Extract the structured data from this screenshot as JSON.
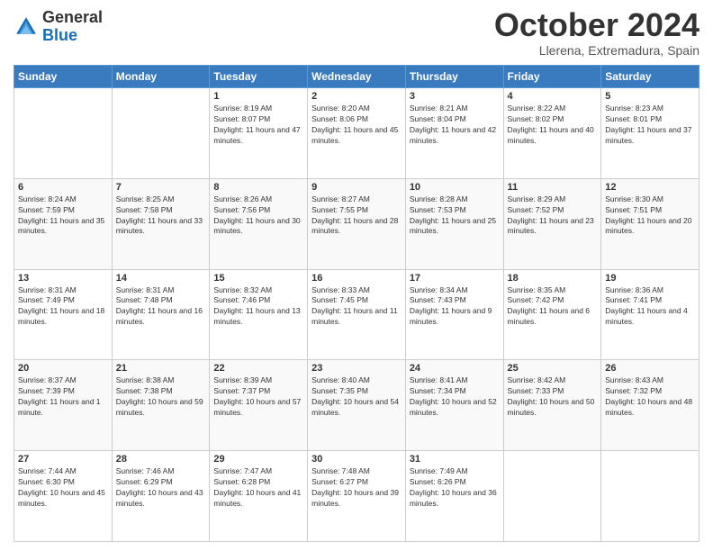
{
  "header": {
    "logo_general": "General",
    "logo_blue": "Blue",
    "month_title": "October 2024",
    "location": "Llerena, Extremadura, Spain"
  },
  "weekdays": [
    "Sunday",
    "Monday",
    "Tuesday",
    "Wednesday",
    "Thursday",
    "Friday",
    "Saturday"
  ],
  "weeks": [
    [
      {
        "day": "",
        "info": ""
      },
      {
        "day": "",
        "info": ""
      },
      {
        "day": "1",
        "info": "Sunrise: 8:19 AM\nSunset: 8:07 PM\nDaylight: 11 hours and 47 minutes."
      },
      {
        "day": "2",
        "info": "Sunrise: 8:20 AM\nSunset: 8:06 PM\nDaylight: 11 hours and 45 minutes."
      },
      {
        "day": "3",
        "info": "Sunrise: 8:21 AM\nSunset: 8:04 PM\nDaylight: 11 hours and 42 minutes."
      },
      {
        "day": "4",
        "info": "Sunrise: 8:22 AM\nSunset: 8:02 PM\nDaylight: 11 hours and 40 minutes."
      },
      {
        "day": "5",
        "info": "Sunrise: 8:23 AM\nSunset: 8:01 PM\nDaylight: 11 hours and 37 minutes."
      }
    ],
    [
      {
        "day": "6",
        "info": "Sunrise: 8:24 AM\nSunset: 7:59 PM\nDaylight: 11 hours and 35 minutes."
      },
      {
        "day": "7",
        "info": "Sunrise: 8:25 AM\nSunset: 7:58 PM\nDaylight: 11 hours and 33 minutes."
      },
      {
        "day": "8",
        "info": "Sunrise: 8:26 AM\nSunset: 7:56 PM\nDaylight: 11 hours and 30 minutes."
      },
      {
        "day": "9",
        "info": "Sunrise: 8:27 AM\nSunset: 7:55 PM\nDaylight: 11 hours and 28 minutes."
      },
      {
        "day": "10",
        "info": "Sunrise: 8:28 AM\nSunset: 7:53 PM\nDaylight: 11 hours and 25 minutes."
      },
      {
        "day": "11",
        "info": "Sunrise: 8:29 AM\nSunset: 7:52 PM\nDaylight: 11 hours and 23 minutes."
      },
      {
        "day": "12",
        "info": "Sunrise: 8:30 AM\nSunset: 7:51 PM\nDaylight: 11 hours and 20 minutes."
      }
    ],
    [
      {
        "day": "13",
        "info": "Sunrise: 8:31 AM\nSunset: 7:49 PM\nDaylight: 11 hours and 18 minutes."
      },
      {
        "day": "14",
        "info": "Sunrise: 8:31 AM\nSunset: 7:48 PM\nDaylight: 11 hours and 16 minutes."
      },
      {
        "day": "15",
        "info": "Sunrise: 8:32 AM\nSunset: 7:46 PM\nDaylight: 11 hours and 13 minutes."
      },
      {
        "day": "16",
        "info": "Sunrise: 8:33 AM\nSunset: 7:45 PM\nDaylight: 11 hours and 11 minutes."
      },
      {
        "day": "17",
        "info": "Sunrise: 8:34 AM\nSunset: 7:43 PM\nDaylight: 11 hours and 9 minutes."
      },
      {
        "day": "18",
        "info": "Sunrise: 8:35 AM\nSunset: 7:42 PM\nDaylight: 11 hours and 6 minutes."
      },
      {
        "day": "19",
        "info": "Sunrise: 8:36 AM\nSunset: 7:41 PM\nDaylight: 11 hours and 4 minutes."
      }
    ],
    [
      {
        "day": "20",
        "info": "Sunrise: 8:37 AM\nSunset: 7:39 PM\nDaylight: 11 hours and 1 minute."
      },
      {
        "day": "21",
        "info": "Sunrise: 8:38 AM\nSunset: 7:38 PM\nDaylight: 10 hours and 59 minutes."
      },
      {
        "day": "22",
        "info": "Sunrise: 8:39 AM\nSunset: 7:37 PM\nDaylight: 10 hours and 57 minutes."
      },
      {
        "day": "23",
        "info": "Sunrise: 8:40 AM\nSunset: 7:35 PM\nDaylight: 10 hours and 54 minutes."
      },
      {
        "day": "24",
        "info": "Sunrise: 8:41 AM\nSunset: 7:34 PM\nDaylight: 10 hours and 52 minutes."
      },
      {
        "day": "25",
        "info": "Sunrise: 8:42 AM\nSunset: 7:33 PM\nDaylight: 10 hours and 50 minutes."
      },
      {
        "day": "26",
        "info": "Sunrise: 8:43 AM\nSunset: 7:32 PM\nDaylight: 10 hours and 48 minutes."
      }
    ],
    [
      {
        "day": "27",
        "info": "Sunrise: 7:44 AM\nSunset: 6:30 PM\nDaylight: 10 hours and 45 minutes."
      },
      {
        "day": "28",
        "info": "Sunrise: 7:46 AM\nSunset: 6:29 PM\nDaylight: 10 hours and 43 minutes."
      },
      {
        "day": "29",
        "info": "Sunrise: 7:47 AM\nSunset: 6:28 PM\nDaylight: 10 hours and 41 minutes."
      },
      {
        "day": "30",
        "info": "Sunrise: 7:48 AM\nSunset: 6:27 PM\nDaylight: 10 hours and 39 minutes."
      },
      {
        "day": "31",
        "info": "Sunrise: 7:49 AM\nSunset: 6:26 PM\nDaylight: 10 hours and 36 minutes."
      },
      {
        "day": "",
        "info": ""
      },
      {
        "day": "",
        "info": ""
      }
    ]
  ]
}
